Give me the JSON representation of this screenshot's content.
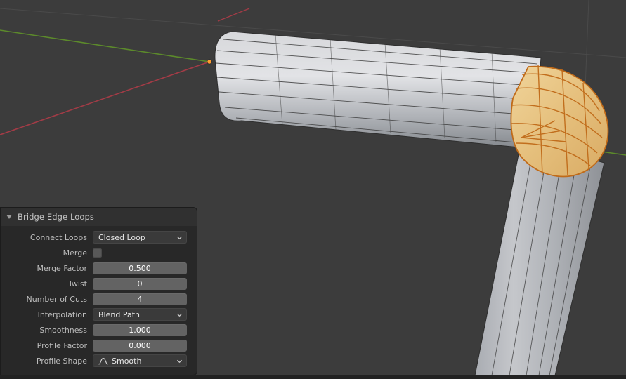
{
  "viewport": {
    "background_color": "#3c3c3c",
    "grid_line_color": "#4a4a4a",
    "axis_x_color": "#a33b46",
    "axis_y_color": "#5c8a2b",
    "origin_dot_color": "#ff9d2e",
    "selection_fill": "#e7c179",
    "selection_edge": "#c06a18",
    "mesh_light": "#d9dadd",
    "mesh_mid": "#b6b8bc",
    "mesh_dark": "#808489",
    "mesh_wire": "#2e2e2e",
    "object_description": "bridged edge loops on an elbow-shaped tube mesh in edit mode",
    "origin_label": "object-origin"
  },
  "panel": {
    "title": "Bridge Edge Loops",
    "expanded": true,
    "collapse_icon": "triangle-down-icon",
    "fields": [
      {
        "label": "Connect Loops",
        "kind": "dropdown",
        "value": "Closed Loop"
      },
      {
        "label": "Merge",
        "kind": "checkbox",
        "value": ""
      },
      {
        "label": "Merge Factor",
        "kind": "number",
        "value": "0.500"
      },
      {
        "label": "Twist",
        "kind": "number",
        "value": "0"
      },
      {
        "label": "Number of Cuts",
        "kind": "number",
        "value": "4"
      },
      {
        "label": "Interpolation",
        "kind": "dropdown",
        "value": "Blend Path"
      },
      {
        "label": "Smoothness",
        "kind": "number",
        "value": "1.000"
      },
      {
        "label": "Profile Factor",
        "kind": "number",
        "value": "0.000"
      },
      {
        "label": "Profile Shape",
        "kind": "dropdown",
        "value": "Smooth",
        "icon": "smooth-curve-icon"
      }
    ]
  }
}
